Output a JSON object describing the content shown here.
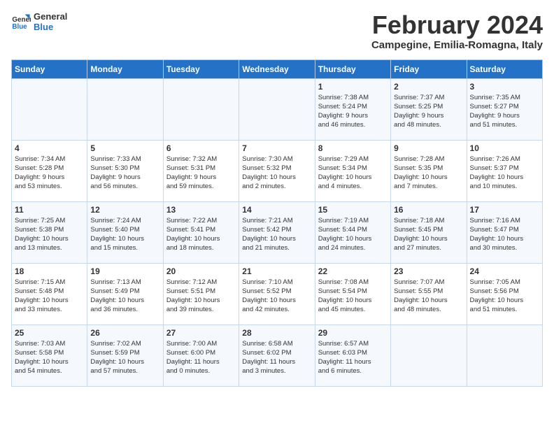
{
  "logo": {
    "general": "General",
    "blue": "Blue"
  },
  "title": "February 2024",
  "subtitle": "Campegine, Emilia-Romagna, Italy",
  "days_of_week": [
    "Sunday",
    "Monday",
    "Tuesday",
    "Wednesday",
    "Thursday",
    "Friday",
    "Saturday"
  ],
  "weeks": [
    [
      {
        "day": "",
        "info": ""
      },
      {
        "day": "",
        "info": ""
      },
      {
        "day": "",
        "info": ""
      },
      {
        "day": "",
        "info": ""
      },
      {
        "day": "1",
        "info": "Sunrise: 7:38 AM\nSunset: 5:24 PM\nDaylight: 9 hours\nand 46 minutes."
      },
      {
        "day": "2",
        "info": "Sunrise: 7:37 AM\nSunset: 5:25 PM\nDaylight: 9 hours\nand 48 minutes."
      },
      {
        "day": "3",
        "info": "Sunrise: 7:35 AM\nSunset: 5:27 PM\nDaylight: 9 hours\nand 51 minutes."
      }
    ],
    [
      {
        "day": "4",
        "info": "Sunrise: 7:34 AM\nSunset: 5:28 PM\nDaylight: 9 hours\nand 53 minutes."
      },
      {
        "day": "5",
        "info": "Sunrise: 7:33 AM\nSunset: 5:30 PM\nDaylight: 9 hours\nand 56 minutes."
      },
      {
        "day": "6",
        "info": "Sunrise: 7:32 AM\nSunset: 5:31 PM\nDaylight: 9 hours\nand 59 minutes."
      },
      {
        "day": "7",
        "info": "Sunrise: 7:30 AM\nSunset: 5:32 PM\nDaylight: 10 hours\nand 2 minutes."
      },
      {
        "day": "8",
        "info": "Sunrise: 7:29 AM\nSunset: 5:34 PM\nDaylight: 10 hours\nand 4 minutes."
      },
      {
        "day": "9",
        "info": "Sunrise: 7:28 AM\nSunset: 5:35 PM\nDaylight: 10 hours\nand 7 minutes."
      },
      {
        "day": "10",
        "info": "Sunrise: 7:26 AM\nSunset: 5:37 PM\nDaylight: 10 hours\nand 10 minutes."
      }
    ],
    [
      {
        "day": "11",
        "info": "Sunrise: 7:25 AM\nSunset: 5:38 PM\nDaylight: 10 hours\nand 13 minutes."
      },
      {
        "day": "12",
        "info": "Sunrise: 7:24 AM\nSunset: 5:40 PM\nDaylight: 10 hours\nand 15 minutes."
      },
      {
        "day": "13",
        "info": "Sunrise: 7:22 AM\nSunset: 5:41 PM\nDaylight: 10 hours\nand 18 minutes."
      },
      {
        "day": "14",
        "info": "Sunrise: 7:21 AM\nSunset: 5:42 PM\nDaylight: 10 hours\nand 21 minutes."
      },
      {
        "day": "15",
        "info": "Sunrise: 7:19 AM\nSunset: 5:44 PM\nDaylight: 10 hours\nand 24 minutes."
      },
      {
        "day": "16",
        "info": "Sunrise: 7:18 AM\nSunset: 5:45 PM\nDaylight: 10 hours\nand 27 minutes."
      },
      {
        "day": "17",
        "info": "Sunrise: 7:16 AM\nSunset: 5:47 PM\nDaylight: 10 hours\nand 30 minutes."
      }
    ],
    [
      {
        "day": "18",
        "info": "Sunrise: 7:15 AM\nSunset: 5:48 PM\nDaylight: 10 hours\nand 33 minutes."
      },
      {
        "day": "19",
        "info": "Sunrise: 7:13 AM\nSunset: 5:49 PM\nDaylight: 10 hours\nand 36 minutes."
      },
      {
        "day": "20",
        "info": "Sunrise: 7:12 AM\nSunset: 5:51 PM\nDaylight: 10 hours\nand 39 minutes."
      },
      {
        "day": "21",
        "info": "Sunrise: 7:10 AM\nSunset: 5:52 PM\nDaylight: 10 hours\nand 42 minutes."
      },
      {
        "day": "22",
        "info": "Sunrise: 7:08 AM\nSunset: 5:54 PM\nDaylight: 10 hours\nand 45 minutes."
      },
      {
        "day": "23",
        "info": "Sunrise: 7:07 AM\nSunset: 5:55 PM\nDaylight: 10 hours\nand 48 minutes."
      },
      {
        "day": "24",
        "info": "Sunrise: 7:05 AM\nSunset: 5:56 PM\nDaylight: 10 hours\nand 51 minutes."
      }
    ],
    [
      {
        "day": "25",
        "info": "Sunrise: 7:03 AM\nSunset: 5:58 PM\nDaylight: 10 hours\nand 54 minutes."
      },
      {
        "day": "26",
        "info": "Sunrise: 7:02 AM\nSunset: 5:59 PM\nDaylight: 10 hours\nand 57 minutes."
      },
      {
        "day": "27",
        "info": "Sunrise: 7:00 AM\nSunset: 6:00 PM\nDaylight: 11 hours\nand 0 minutes."
      },
      {
        "day": "28",
        "info": "Sunrise: 6:58 AM\nSunset: 6:02 PM\nDaylight: 11 hours\nand 3 minutes."
      },
      {
        "day": "29",
        "info": "Sunrise: 6:57 AM\nSunset: 6:03 PM\nDaylight: 11 hours\nand 6 minutes."
      },
      {
        "day": "",
        "info": ""
      },
      {
        "day": "",
        "info": ""
      }
    ]
  ]
}
